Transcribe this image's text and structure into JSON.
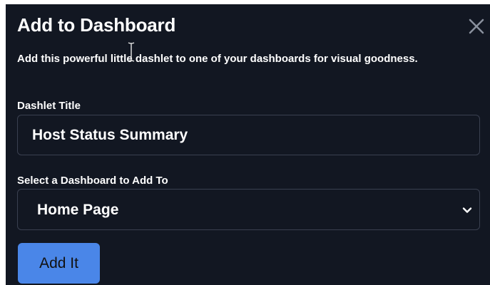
{
  "dialog": {
    "title": "Add to Dashboard",
    "close_icon": "close-icon",
    "description": "Add this powerful little dashlet to one of your dashboards for visual goodness.",
    "dashlet_title_label": "Dashlet Title",
    "dashlet_title_value": "Host Status Summary",
    "dashboard_select_label": "Select a Dashboard to Add To",
    "dashboard_selected": "Home Page",
    "dropdown_icon": "chevron-down-icon",
    "submit_label": "Add It"
  },
  "colors": {
    "background": "#121722",
    "border": "#3a4050",
    "text": "#ffffff",
    "accent": "#4a86e8"
  }
}
